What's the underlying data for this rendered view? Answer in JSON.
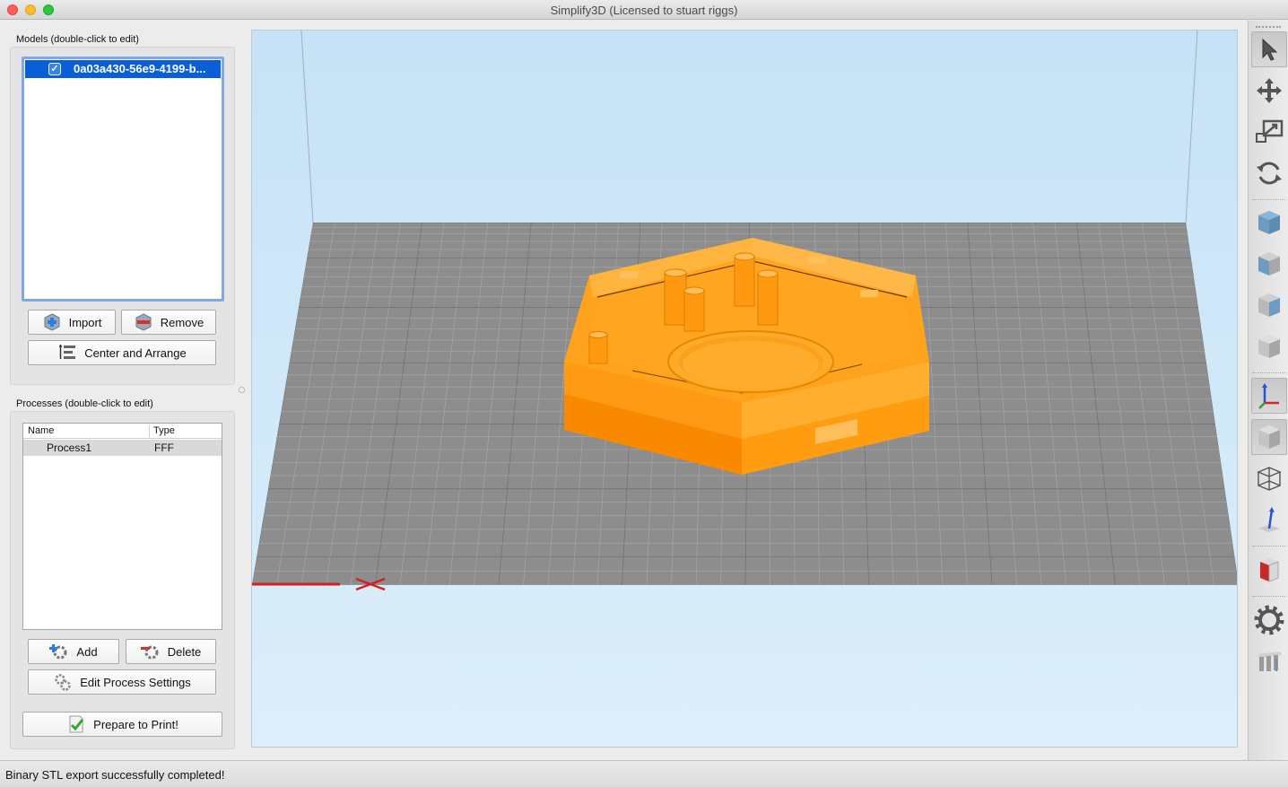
{
  "window": {
    "title": "Simplify3D (Licensed to stuart riggs)"
  },
  "models": {
    "label": "Models (double-click to edit)",
    "items": [
      {
        "name": "0a03a430-56e9-4199-b...",
        "checked": true
      }
    ],
    "import_label": "Import",
    "remove_label": "Remove",
    "center_arrange_label": "Center and Arrange"
  },
  "processes": {
    "label": "Processes (double-click to edit)",
    "columns": [
      "Name",
      "Type"
    ],
    "rows": [
      {
        "name": "Process1",
        "type": "FFF"
      }
    ],
    "add_label": "Add",
    "delete_label": "Delete",
    "edit_label": "Edit Process Settings",
    "prepare_label": "Prepare to Print!"
  },
  "toolbar": {
    "tools": [
      "select-icon",
      "move-icon",
      "scale-icon",
      "rotate-icon",
      "view-top-icon",
      "view-front-icon",
      "view-side-icon",
      "view-iso-icon",
      "axes-icon",
      "solid-shading-icon",
      "wireframe-icon",
      "normals-icon",
      "cross-section-icon",
      "settings-gear-icon",
      "supports-icon"
    ]
  },
  "status": {
    "message": "Binary STL export successfully completed!"
  },
  "colors": {
    "model": "#ff9d0a",
    "bed": "#8c8c8c",
    "background": "#c9e4f7",
    "selection": "#0a5fd8"
  }
}
